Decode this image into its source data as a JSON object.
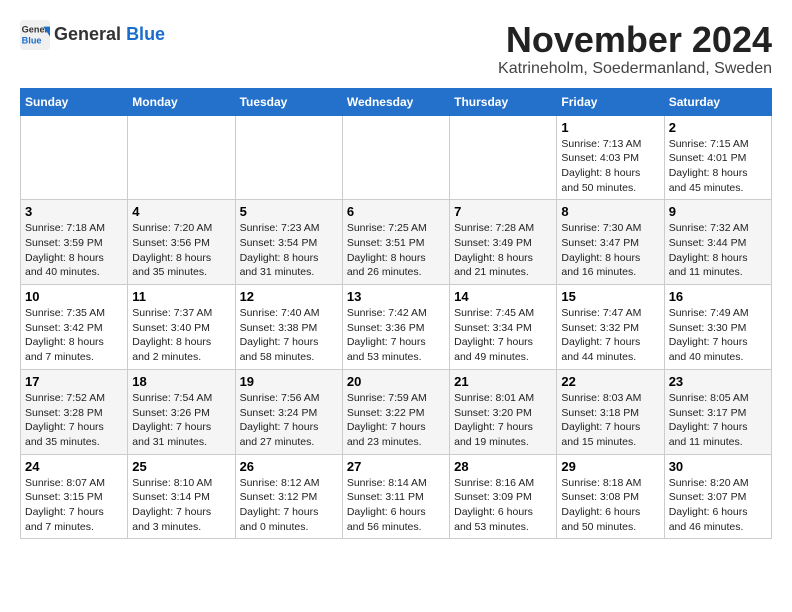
{
  "header": {
    "logo": {
      "general": "General",
      "blue": "Blue"
    },
    "title": "November 2024",
    "location": "Katrineholm, Soedermanland, Sweden"
  },
  "weekdays": [
    "Sunday",
    "Monday",
    "Tuesday",
    "Wednesday",
    "Thursday",
    "Friday",
    "Saturday"
  ],
  "weeks": [
    [
      {
        "day": "",
        "sunrise": "",
        "sunset": "",
        "daylight": ""
      },
      {
        "day": "",
        "sunrise": "",
        "sunset": "",
        "daylight": ""
      },
      {
        "day": "",
        "sunrise": "",
        "sunset": "",
        "daylight": ""
      },
      {
        "day": "",
        "sunrise": "",
        "sunset": "",
        "daylight": ""
      },
      {
        "day": "",
        "sunrise": "",
        "sunset": "",
        "daylight": ""
      },
      {
        "day": "1",
        "sunrise": "Sunrise: 7:13 AM",
        "sunset": "Sunset: 4:03 PM",
        "daylight": "Daylight: 8 hours and 50 minutes."
      },
      {
        "day": "2",
        "sunrise": "Sunrise: 7:15 AM",
        "sunset": "Sunset: 4:01 PM",
        "daylight": "Daylight: 8 hours and 45 minutes."
      }
    ],
    [
      {
        "day": "3",
        "sunrise": "Sunrise: 7:18 AM",
        "sunset": "Sunset: 3:59 PM",
        "daylight": "Daylight: 8 hours and 40 minutes."
      },
      {
        "day": "4",
        "sunrise": "Sunrise: 7:20 AM",
        "sunset": "Sunset: 3:56 PM",
        "daylight": "Daylight: 8 hours and 35 minutes."
      },
      {
        "day": "5",
        "sunrise": "Sunrise: 7:23 AM",
        "sunset": "Sunset: 3:54 PM",
        "daylight": "Daylight: 8 hours and 31 minutes."
      },
      {
        "day": "6",
        "sunrise": "Sunrise: 7:25 AM",
        "sunset": "Sunset: 3:51 PM",
        "daylight": "Daylight: 8 hours and 26 minutes."
      },
      {
        "day": "7",
        "sunrise": "Sunrise: 7:28 AM",
        "sunset": "Sunset: 3:49 PM",
        "daylight": "Daylight: 8 hours and 21 minutes."
      },
      {
        "day": "8",
        "sunrise": "Sunrise: 7:30 AM",
        "sunset": "Sunset: 3:47 PM",
        "daylight": "Daylight: 8 hours and 16 minutes."
      },
      {
        "day": "9",
        "sunrise": "Sunrise: 7:32 AM",
        "sunset": "Sunset: 3:44 PM",
        "daylight": "Daylight: 8 hours and 11 minutes."
      }
    ],
    [
      {
        "day": "10",
        "sunrise": "Sunrise: 7:35 AM",
        "sunset": "Sunset: 3:42 PM",
        "daylight": "Daylight: 8 hours and 7 minutes."
      },
      {
        "day": "11",
        "sunrise": "Sunrise: 7:37 AM",
        "sunset": "Sunset: 3:40 PM",
        "daylight": "Daylight: 8 hours and 2 minutes."
      },
      {
        "day": "12",
        "sunrise": "Sunrise: 7:40 AM",
        "sunset": "Sunset: 3:38 PM",
        "daylight": "Daylight: 7 hours and 58 minutes."
      },
      {
        "day": "13",
        "sunrise": "Sunrise: 7:42 AM",
        "sunset": "Sunset: 3:36 PM",
        "daylight": "Daylight: 7 hours and 53 minutes."
      },
      {
        "day": "14",
        "sunrise": "Sunrise: 7:45 AM",
        "sunset": "Sunset: 3:34 PM",
        "daylight": "Daylight: 7 hours and 49 minutes."
      },
      {
        "day": "15",
        "sunrise": "Sunrise: 7:47 AM",
        "sunset": "Sunset: 3:32 PM",
        "daylight": "Daylight: 7 hours and 44 minutes."
      },
      {
        "day": "16",
        "sunrise": "Sunrise: 7:49 AM",
        "sunset": "Sunset: 3:30 PM",
        "daylight": "Daylight: 7 hours and 40 minutes."
      }
    ],
    [
      {
        "day": "17",
        "sunrise": "Sunrise: 7:52 AM",
        "sunset": "Sunset: 3:28 PM",
        "daylight": "Daylight: 7 hours and 35 minutes."
      },
      {
        "day": "18",
        "sunrise": "Sunrise: 7:54 AM",
        "sunset": "Sunset: 3:26 PM",
        "daylight": "Daylight: 7 hours and 31 minutes."
      },
      {
        "day": "19",
        "sunrise": "Sunrise: 7:56 AM",
        "sunset": "Sunset: 3:24 PM",
        "daylight": "Daylight: 7 hours and 27 minutes."
      },
      {
        "day": "20",
        "sunrise": "Sunrise: 7:59 AM",
        "sunset": "Sunset: 3:22 PM",
        "daylight": "Daylight: 7 hours and 23 minutes."
      },
      {
        "day": "21",
        "sunrise": "Sunrise: 8:01 AM",
        "sunset": "Sunset: 3:20 PM",
        "daylight": "Daylight: 7 hours and 19 minutes."
      },
      {
        "day": "22",
        "sunrise": "Sunrise: 8:03 AM",
        "sunset": "Sunset: 3:18 PM",
        "daylight": "Daylight: 7 hours and 15 minutes."
      },
      {
        "day": "23",
        "sunrise": "Sunrise: 8:05 AM",
        "sunset": "Sunset: 3:17 PM",
        "daylight": "Daylight: 7 hours and 11 minutes."
      }
    ],
    [
      {
        "day": "24",
        "sunrise": "Sunrise: 8:07 AM",
        "sunset": "Sunset: 3:15 PM",
        "daylight": "Daylight: 7 hours and 7 minutes."
      },
      {
        "day": "25",
        "sunrise": "Sunrise: 8:10 AM",
        "sunset": "Sunset: 3:14 PM",
        "daylight": "Daylight: 7 hours and 3 minutes."
      },
      {
        "day": "26",
        "sunrise": "Sunrise: 8:12 AM",
        "sunset": "Sunset: 3:12 PM",
        "daylight": "Daylight: 7 hours and 0 minutes."
      },
      {
        "day": "27",
        "sunrise": "Sunrise: 8:14 AM",
        "sunset": "Sunset: 3:11 PM",
        "daylight": "Daylight: 6 hours and 56 minutes."
      },
      {
        "day": "28",
        "sunrise": "Sunrise: 8:16 AM",
        "sunset": "Sunset: 3:09 PM",
        "daylight": "Daylight: 6 hours and 53 minutes."
      },
      {
        "day": "29",
        "sunrise": "Sunrise: 8:18 AM",
        "sunset": "Sunset: 3:08 PM",
        "daylight": "Daylight: 6 hours and 50 minutes."
      },
      {
        "day": "30",
        "sunrise": "Sunrise: 8:20 AM",
        "sunset": "Sunset: 3:07 PM",
        "daylight": "Daylight: 6 hours and 46 minutes."
      }
    ]
  ]
}
